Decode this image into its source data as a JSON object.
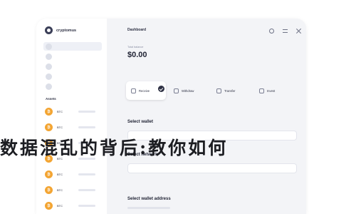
{
  "app": {
    "name": "cryptomus"
  },
  "sidebar": {
    "nav_items": [
      {
        "active": true
      },
      {
        "active": false
      },
      {
        "active": false
      },
      {
        "active": false
      },
      {
        "active": false
      }
    ],
    "assets_title": "Assets",
    "assets": [
      {
        "symbol": "₿",
        "name": "BTC"
      },
      {
        "symbol": "₿",
        "name": "BTC"
      },
      {
        "symbol": "₿",
        "name": "BTC"
      },
      {
        "symbol": "₿",
        "name": "BTC"
      },
      {
        "symbol": "₿",
        "name": "BTC"
      },
      {
        "symbol": "₿",
        "name": "BTC"
      },
      {
        "symbol": "₿",
        "name": "BTC"
      }
    ]
  },
  "main": {
    "title": "Dashboard",
    "balance_label": "Total balance",
    "balance": "$0.00",
    "actions": [
      {
        "label": "Receive",
        "selected": true
      },
      {
        "label": "Withdraw",
        "selected": false
      },
      {
        "label": "Transfer",
        "selected": false
      },
      {
        "label": "Invest",
        "selected": false
      }
    ],
    "select_wallet": "Select wallet",
    "select_network": "Select network",
    "select_address": "Select wallet address"
  },
  "overlay": {
    "headline": "数据混乱的背后:教你如何"
  }
}
